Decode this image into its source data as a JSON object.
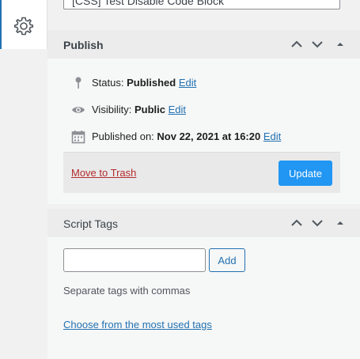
{
  "post_title": "[CSS] Test Disable Code Block",
  "sidebar": {
    "settings_icon": "gear-icon"
  },
  "publish": {
    "title": "Publish",
    "status_label": "Status:",
    "status_value": "Published",
    "status_edit": "Edit",
    "visibility_label": "Visibility:",
    "visibility_value": "Public",
    "visibility_edit": "Edit",
    "published_label": "Published on:",
    "published_value": "Nov 22, 2021 at 16:20",
    "published_edit": "Edit",
    "trash_label": "Move to Trash",
    "update_label": "Update"
  },
  "tags": {
    "title": "Script Tags",
    "input_value": "",
    "input_placeholder": "",
    "add_label": "Add",
    "hint": "Separate tags with commas",
    "most_used_link": "Choose from the most used tags"
  },
  "colors": {
    "accent": "#2271b1",
    "button": "#2196f3",
    "danger": "#b32d2e"
  }
}
